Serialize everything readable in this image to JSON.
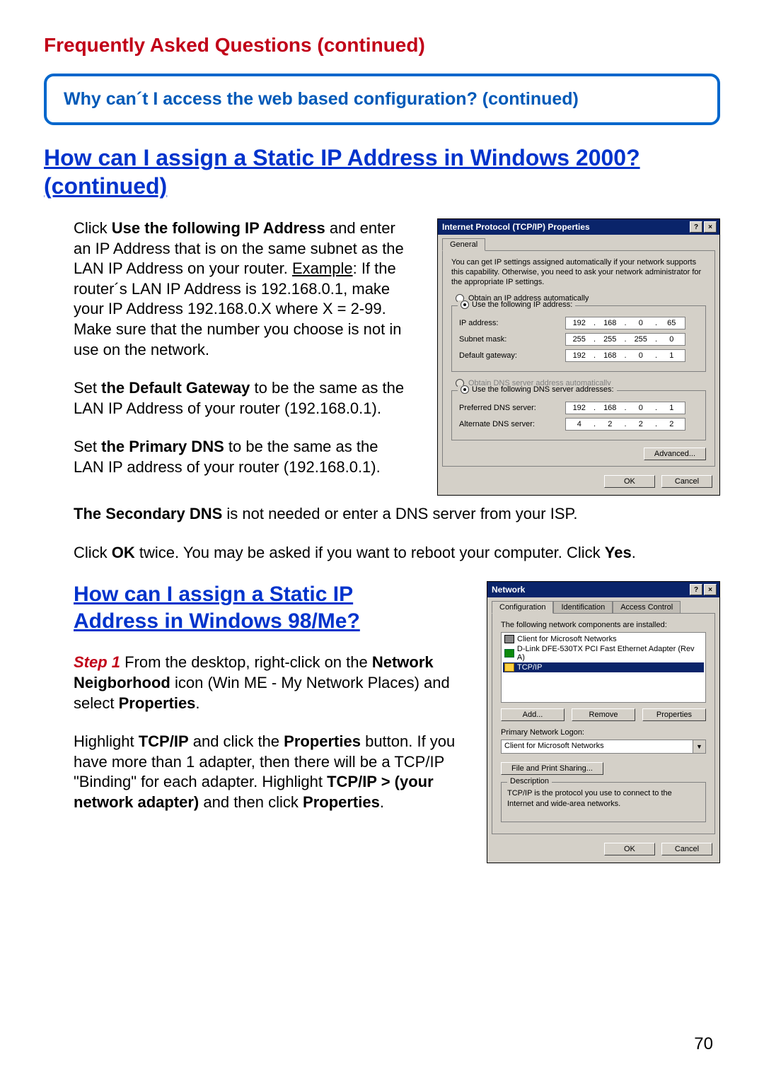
{
  "page_number": "70",
  "faq_title": "Frequently Asked Questions (continued)",
  "banner": "Why can´t I access the web based configuration? (continued)",
  "q1_heading": "How can I assign a Static IP Address in Windows 2000? (continued)",
  "p1_pre": "Click ",
  "p1_b1": "Use the following IP Address",
  "p1_mid1": " and enter an IP Address that is on the same subnet as the LAN IP Address on your router. ",
  "p1_ex": "Example",
  "p1_mid2": ": If the router´s LAN IP Address is 192.168.0.1, make your IP Address 192.168.0.X where X = 2-99. Make sure that the number you choose is not in use on the network.",
  "p2_pre": "Set ",
  "p2_b": "the Default Gateway",
  "p2_post": " to be the same as the LAN IP Address of your router (192.168.0.1).",
  "p3_pre": "Set ",
  "p3_b": "the Primary DNS",
  "p3_post": " to be the same as the LAN IP address of your router (192.168.0.1).",
  "p4_b": "The Secondary DNS",
  "p4_post": " is not needed or enter a DNS server from your ISP.",
  "p5_pre": "Click ",
  "p5_b1": "OK",
  "p5_mid": " twice. You may be asked if you want to reboot your computer. Click ",
  "p5_b2": "Yes",
  "p5_post": ".",
  "q2_heading": "How can I assign a Static IP Address in Windows 98/Me?",
  "s1_step": "Step 1",
  "s1_a": " From the desktop, right-click on the ",
  "s1_b1": "Network Neigborhood",
  "s1_c": " icon (Win ME - My Network Places) and select ",
  "s1_b2": "Properties",
  "s1_d": ".",
  "s2_a": "Highlight ",
  "s2_b1": "TCP/IP",
  "s2_c": " and click the ",
  "s2_b2": "Properties",
  "s2_d": " button. If you have more than 1 adapter, then there will be a TCP/IP \"Binding\" for each adapter. Highlight ",
  "s2_b3": "TCP/IP > (your network adapter)",
  "s2_e": " and then click ",
  "s2_b4": "Properties",
  "s2_f": ".",
  "dlg1": {
    "title": "Internet Protocol (TCP/IP) Properties",
    "tab": "General",
    "desc": "You can get IP settings assigned automatically if your network supports this capability. Otherwise, you need to ask your network administrator for the appropriate IP settings.",
    "opt_auto_ip": "Obtain an IP address automatically",
    "opt_use_ip": "Use the following IP address:",
    "lbl_ip": "IP address:",
    "lbl_mask": "Subnet mask:",
    "lbl_gw": "Default gateway:",
    "ip": [
      "192",
      "168",
      "0",
      "65"
    ],
    "mask": [
      "255",
      "255",
      "255",
      "0"
    ],
    "gw": [
      "192",
      "168",
      "0",
      "1"
    ],
    "opt_auto_dns": "Obtain DNS server address automatically",
    "opt_use_dns": "Use the following DNS server addresses:",
    "lbl_pdns": "Preferred DNS server:",
    "lbl_adns": "Alternate DNS server:",
    "pdns": [
      "192",
      "168",
      "0",
      "1"
    ],
    "adns": [
      "4",
      "2",
      "2",
      "2"
    ],
    "btn_adv": "Advanced...",
    "btn_ok": "OK",
    "btn_cancel": "Cancel"
  },
  "dlg2": {
    "title": "Network",
    "tab1": "Configuration",
    "tab2": "Identification",
    "tab3": "Access Control",
    "list_label": "The following network components are installed:",
    "item1": "Client for Microsoft Networks",
    "item2": "D-Link DFE-530TX PCI Fast Ethernet Adapter (Rev A)",
    "item3": "TCP/IP",
    "btn_add": "Add...",
    "btn_remove": "Remove",
    "btn_props": "Properties",
    "lbl_logon": "Primary Network Logon:",
    "logon_val": "Client for Microsoft Networks",
    "btn_fps": "File and Print Sharing...",
    "grp_desc": "Description",
    "desc_text": "TCP/IP is the protocol you use to connect to the Internet and wide-area networks.",
    "btn_ok": "OK",
    "btn_cancel": "Cancel"
  }
}
